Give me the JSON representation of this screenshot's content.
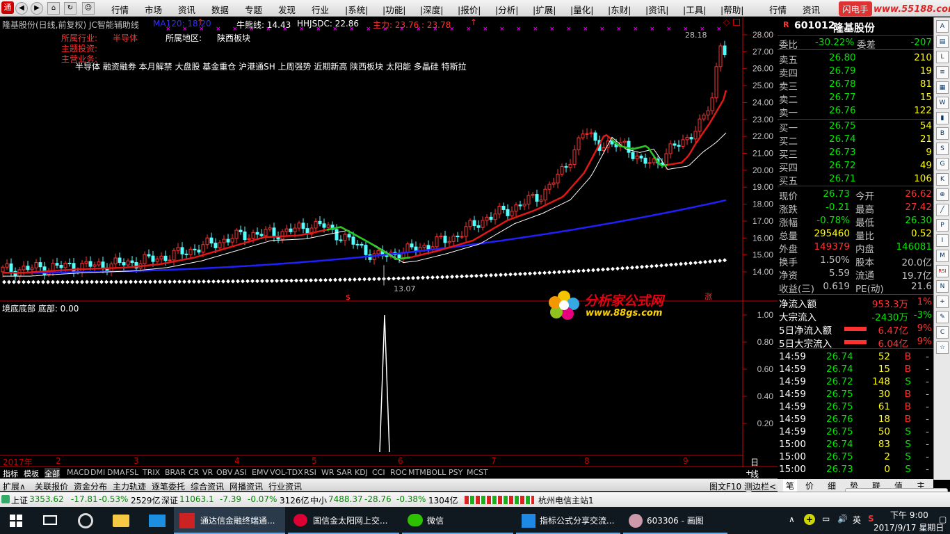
{
  "menu": [
    "行情",
    "市场",
    "资讯",
    "数据",
    "专题",
    "发现",
    "行业",
    "|系统|",
    "|功能|",
    "|深度|",
    "|报价|",
    "|分析|",
    "|扩展|",
    "|量化|",
    "|东财|",
    "|资讯|",
    "|工具|",
    "|帮助|",
    "行情",
    "资讯",
    "闪电手"
  ],
  "watermark": "www.55188.com",
  "chart": {
    "title": "隆基股份(日线,前复权) JC智能辅助线",
    "ma": "MA120: 18.20",
    "bull": "牛熊线: 14.43",
    "hhjs": "HHJSDC: 22.86",
    "zl": "主力: 23.76 : 23.78",
    "industry_label": "所属行业:",
    "industry": "半导体",
    "region_label": "所属地区:",
    "region": "陕西板块",
    "hot_label": "主题投资:",
    "biz_label": "主营业务:",
    "concepts": "半导体 融资融券 本月解禁 大盘股 基金重仓 沪港通SH 上周强势 近期新高 陕西板块 太阳能 多晶硅 特斯拉",
    "high_mark": "28.18",
    "low_mark": "13.07",
    "price_ticks": [
      "28.00",
      "27.00",
      "26.00",
      "25.00",
      "24.00",
      "23.00",
      "22.00",
      "21.00",
      "20.00",
      "19.00",
      "18.00",
      "17.00",
      "16.00",
      "15.00",
      "14.00"
    ],
    "sub_title": "境底底部 底部: 0.00",
    "sub_ticks": [
      "1.00",
      "0.80",
      "0.60",
      "0.40",
      "0.20"
    ],
    "x_labels": [
      "2017年",
      "2",
      "3",
      "4",
      "5",
      "6",
      "7",
      "8",
      "9"
    ],
    "period": "日线",
    "signal_s": "$",
    "signal_zhang": "涨"
  },
  "logo": {
    "cn": "分析家公式网",
    "url": "www.88gs.com"
  },
  "quote": {
    "code": "601012",
    "name": "隆基股份",
    "flag": "R",
    "wb_label": "委比",
    "wb": "-30.22%",
    "wc_label": "委差",
    "wc": "-207",
    "asks": [
      {
        "l": "卖五",
        "p": "26.80",
        "v": "210"
      },
      {
        "l": "卖四",
        "p": "26.79",
        "v": "19"
      },
      {
        "l": "卖三",
        "p": "26.78",
        "v": "81"
      },
      {
        "l": "卖二",
        "p": "26.77",
        "v": "15"
      },
      {
        "l": "卖一",
        "p": "26.76",
        "v": "122"
      }
    ],
    "bids": [
      {
        "l": "买一",
        "p": "26.75",
        "v": "54"
      },
      {
        "l": "买二",
        "p": "26.74",
        "v": "21"
      },
      {
        "l": "买三",
        "p": "26.73",
        "v": "9"
      },
      {
        "l": "买四",
        "p": "26.72",
        "v": "49"
      },
      {
        "l": "买五",
        "p": "26.71",
        "v": "106"
      }
    ],
    "stats": [
      {
        "l1": "现价",
        "v1": "26.73",
        "l2": "今开",
        "v2": "26.62"
      },
      {
        "l1": "涨跌",
        "v1": "-0.21",
        "l2": "最高",
        "v2": "27.42"
      },
      {
        "l1": "涨幅",
        "v1": "-0.78%",
        "l2": "最低",
        "v2": "26.30"
      },
      {
        "l1": "总量",
        "v1": "295460",
        "l2": "量比",
        "v2": "0.52"
      },
      {
        "l1": "外盘",
        "v1": "149379",
        "l2": "内盘",
        "v2": "146081"
      },
      {
        "l1": "换手",
        "v1": "1.50%",
        "l2": "股本",
        "v2": "20.0亿"
      },
      {
        "l1": "净资",
        "v1": "5.59",
        "l2": "流通",
        "v2": "19.7亿"
      },
      {
        "l1": "收益(三)",
        "v1": "0.619",
        "l2": "PE(动)",
        "v2": "21.6"
      }
    ],
    "flows": [
      {
        "l": "净流入额",
        "v": "953.3万",
        "p": "1%"
      },
      {
        "l": "大宗流入",
        "v": "-2430万",
        "p": "-3%"
      },
      {
        "l": "5日净流入额",
        "v": "6.47亿",
        "p": "9%"
      },
      {
        "l": "5日大宗流入",
        "v": "6.04亿",
        "p": "9%"
      }
    ],
    "ticks": [
      {
        "t": "14:59",
        "p": "26.74",
        "v": "52",
        "s": "B"
      },
      {
        "t": "14:59",
        "p": "26.74",
        "v": "15",
        "s": "B"
      },
      {
        "t": "14:59",
        "p": "26.72",
        "v": "148",
        "s": "S"
      },
      {
        "t": "14:59",
        "p": "26.75",
        "v": "30",
        "s": "B"
      },
      {
        "t": "14:59",
        "p": "26.75",
        "v": "61",
        "s": "B"
      },
      {
        "t": "14:59",
        "p": "26.76",
        "v": "18",
        "s": "B"
      },
      {
        "t": "14:59",
        "p": "26.75",
        "v": "50",
        "s": "S"
      },
      {
        "t": "15:00",
        "p": "26.74",
        "v": "83",
        "s": "S"
      },
      {
        "t": "15:00",
        "p": "26.75",
        "v": "2",
        "s": "S"
      },
      {
        "t": "15:00",
        "p": "26.73",
        "v": "0",
        "s": "S"
      }
    ],
    "btabs": [
      "笔",
      "价",
      "细",
      "势",
      "联",
      "值",
      "主"
    ]
  },
  "indicators": [
    "指标",
    "模板",
    "全部",
    "MACD",
    "DMI",
    "DMA",
    "FSL",
    "TRIX",
    "BRAR",
    "CR",
    "VR",
    "OBV",
    "ASI",
    "EMV",
    "VOL-TDX",
    "RSI",
    "WR",
    "SAR",
    "KDJ",
    "CCI",
    "ROC",
    "MTM",
    "BOLL",
    "PSY",
    "MCST"
  ],
  "bottom_tabs": [
    "扩展∧",
    "关联报价",
    "资金分布",
    "主力轨迹",
    "逐笔委托",
    "综合资讯",
    "网播资讯",
    "行业资讯"
  ],
  "bottom_right": [
    "图文F10",
    "测边栏<"
  ],
  "status": {
    "sh_label": "上证",
    "sh": "3353.62",
    "sh_chg": "-17.81",
    "sh_pct": "-0.53%",
    "sh_amt": "2529亿",
    "sz_label": "深证",
    "sz": "11063.1",
    "sz_chg": "-7.39",
    "sz_pct": "-0.07%",
    "sz_amt": "3126亿",
    "zx_label": "中小",
    "zx": "7488.37",
    "zx_chg": "-28.76",
    "zx_pct": "-0.38%",
    "zx_amt": "1304亿",
    "server": "杭州电信主站1"
  },
  "taskbar": {
    "items": [
      "通达信金融终端通...",
      "国信金太阳网上交...",
      "微信",
      "指标公式分享交流...",
      "603306 - 画图"
    ],
    "time": "下午 9:00",
    "date": "2017/9/17 星期日"
  }
}
